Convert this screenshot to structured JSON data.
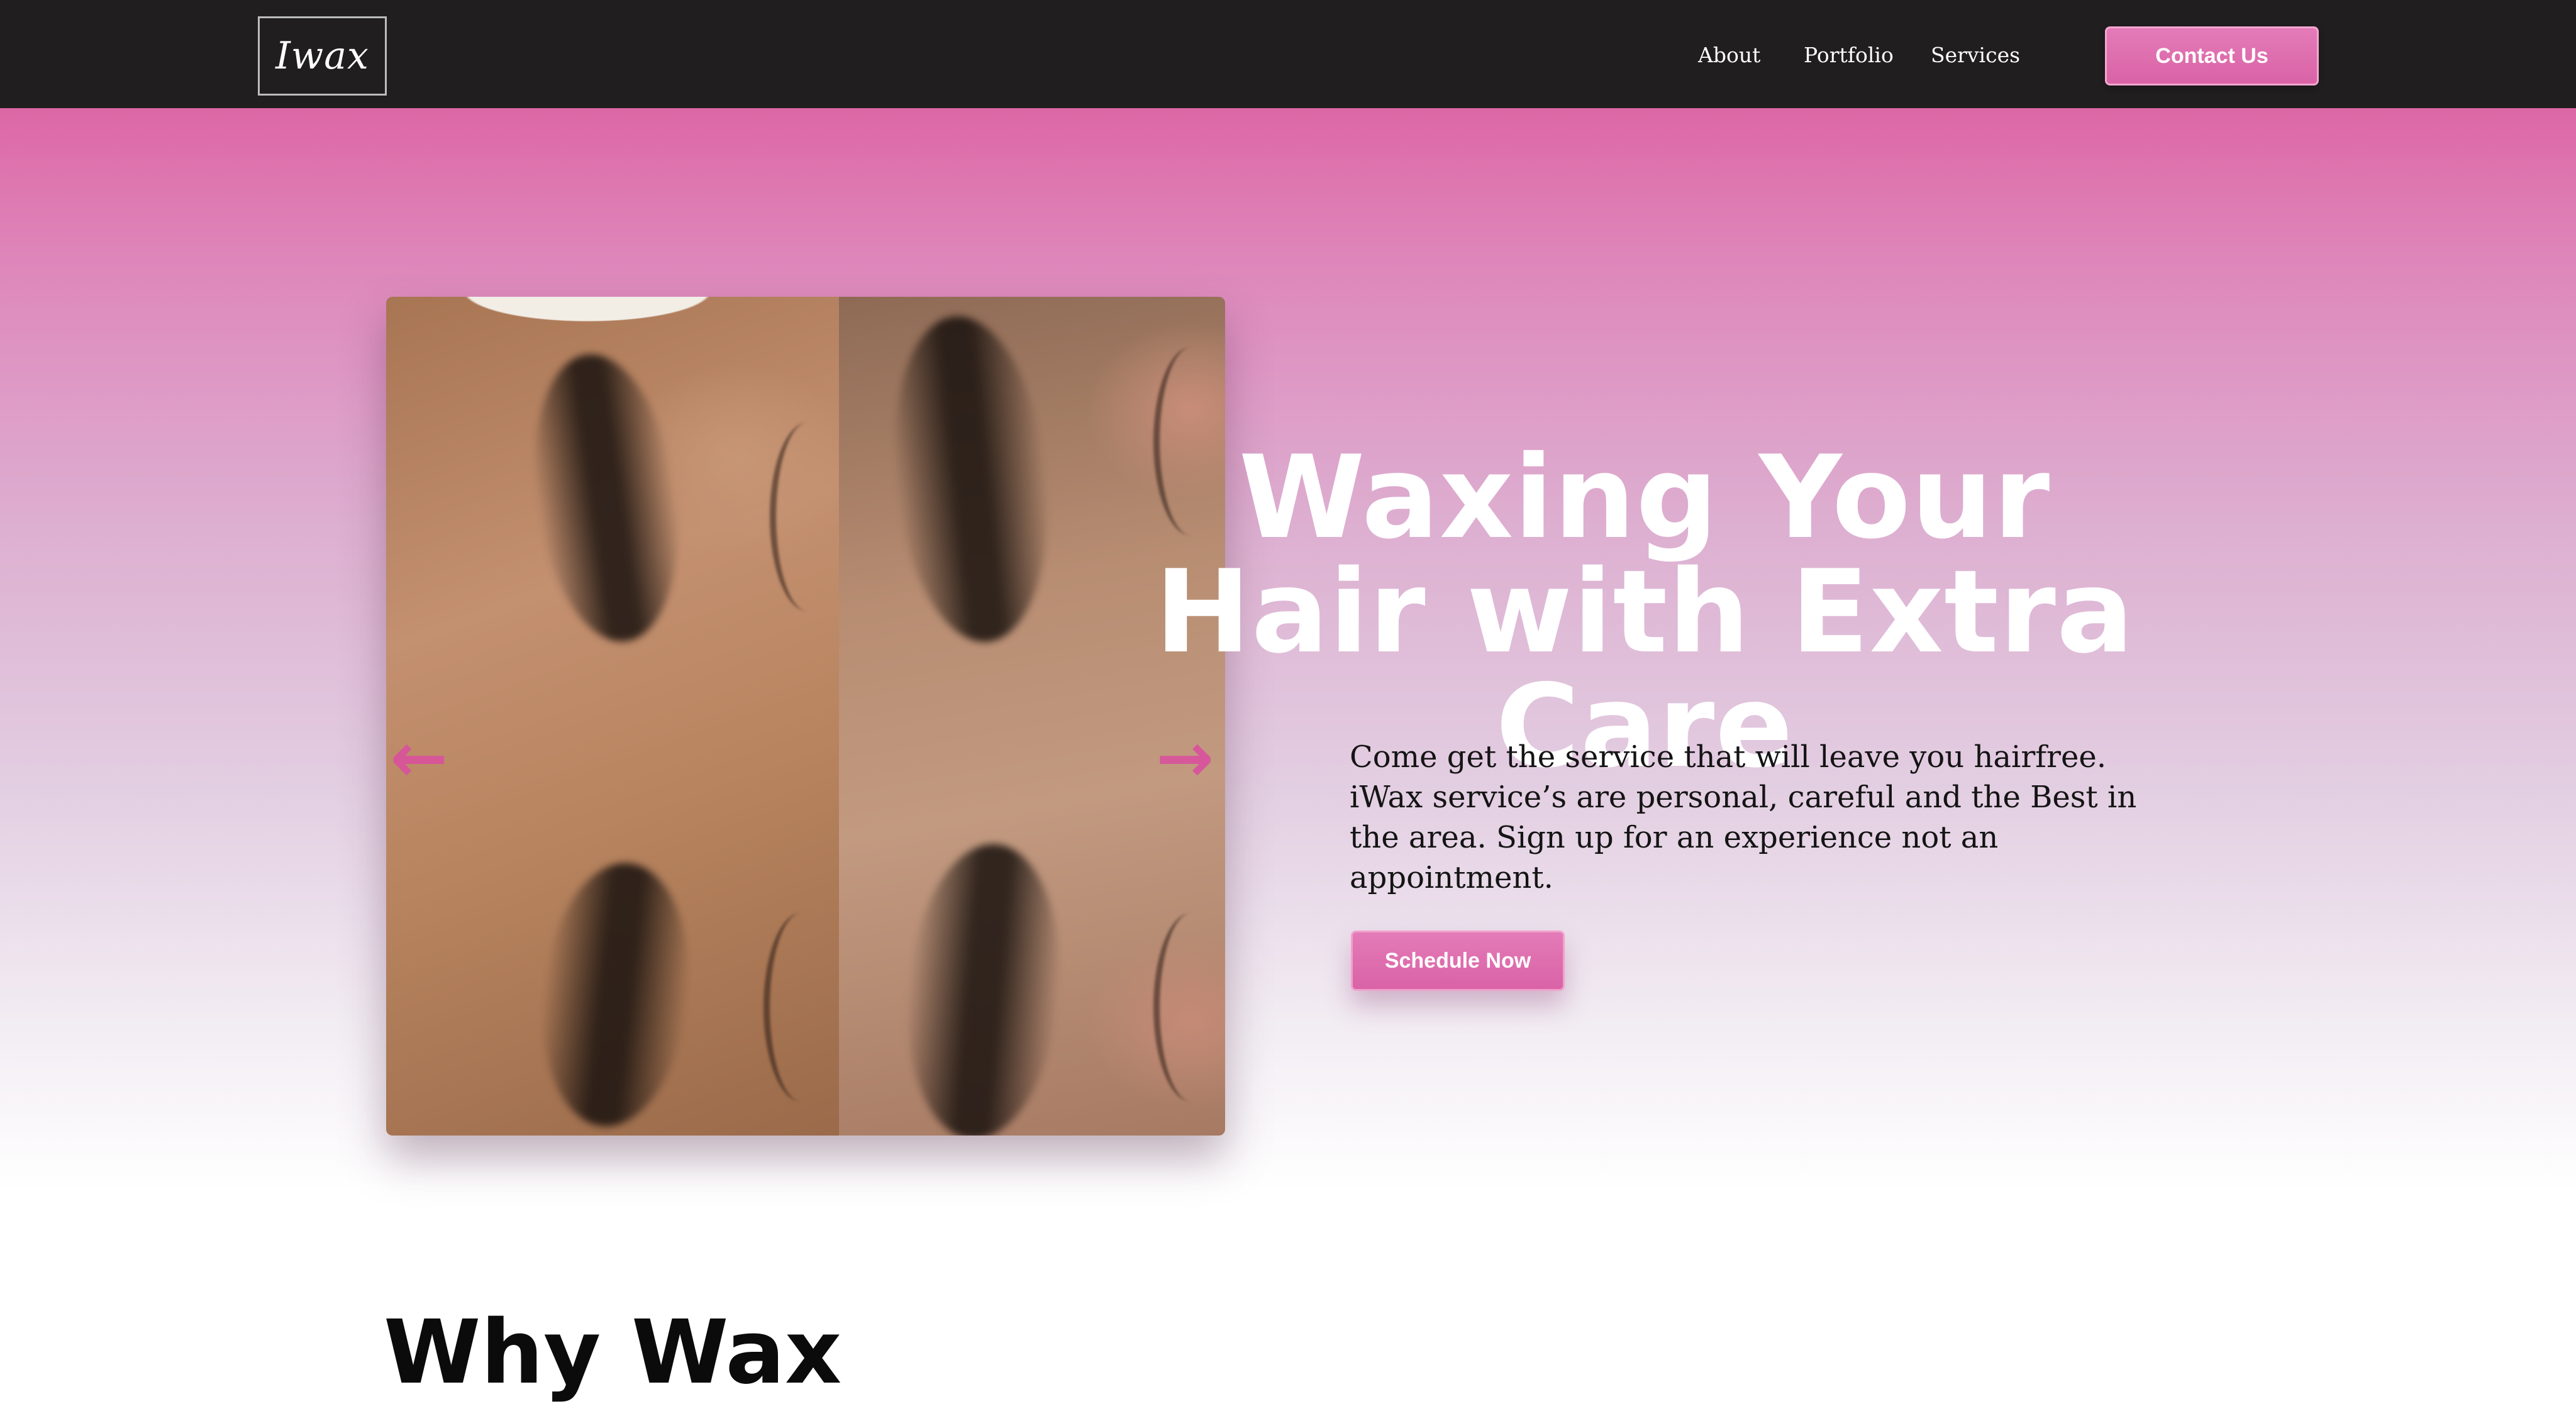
{
  "navbar": {
    "logo_text": "Iwax",
    "links": [
      "About",
      "Portfolio",
      "Services"
    ],
    "contact_label": "Contact Us"
  },
  "hero": {
    "carousel": {
      "prev_icon": "←",
      "next_icon": "→"
    },
    "title": "Waxing Your Hair with Extra Care",
    "description": "Come get the service that will leave you hairfree. iWax service’s are personal, careful and the Best in the area. Sign up for an experience not an appointment.",
    "cta_label": "Schedule Now"
  },
  "next_section": {
    "heading": "Why Wax"
  },
  "colors": {
    "navbar_bg": "#201e1f",
    "accent_pink": "#dd67a6",
    "arrow_pink": "#d9519d"
  }
}
